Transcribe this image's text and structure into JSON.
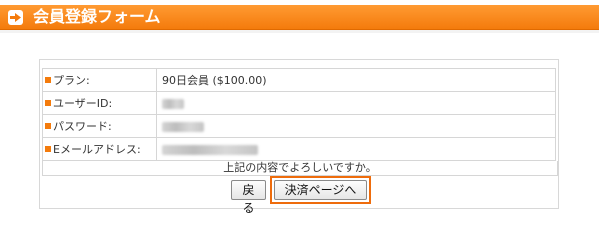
{
  "header": {
    "title": "会員登録フォーム",
    "icon": "arrow-right-icon",
    "accent_color": "#f47b0c"
  },
  "form": {
    "rows": [
      {
        "label": "プラン:",
        "value": "90日会員 ($100.00)"
      },
      {
        "label": "ユーザーID:",
        "value": ""
      },
      {
        "label": "パスワード:",
        "value": ""
      },
      {
        "label": "Eメールアドレス:",
        "value": ""
      }
    ],
    "confirm_text": "上記の内容でよろしいですか。"
  },
  "buttons": {
    "back_label": "戻る",
    "pay_label": "決済ページへ"
  }
}
